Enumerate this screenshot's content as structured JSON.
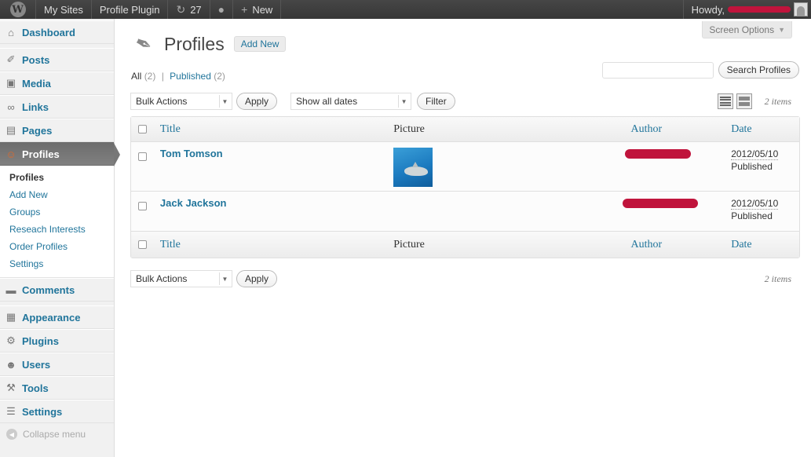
{
  "adminbar": {
    "my_sites": "My Sites",
    "site_name": "Profile Plugin",
    "updates_count": "27",
    "new_label": "New",
    "howdy": "Howdy,"
  },
  "sidebar": {
    "items": [
      {
        "label": "Dashboard",
        "icon": "dashboard-icon"
      },
      {
        "label": "Posts",
        "icon": "pin-icon"
      },
      {
        "label": "Media",
        "icon": "media-icon"
      },
      {
        "label": "Links",
        "icon": "link-icon"
      },
      {
        "label": "Pages",
        "icon": "pages-icon"
      },
      {
        "label": "Profiles",
        "icon": "person-icon"
      },
      {
        "label": "Comments",
        "icon": "comment-icon"
      },
      {
        "label": "Appearance",
        "icon": "appearance-icon"
      },
      {
        "label": "Plugins",
        "icon": "plugin-icon"
      },
      {
        "label": "Users",
        "icon": "users-icon"
      },
      {
        "label": "Tools",
        "icon": "tools-icon"
      },
      {
        "label": "Settings",
        "icon": "settings-icon"
      }
    ],
    "submenu": [
      "Profiles",
      "Add New",
      "Groups",
      "Reseach Interests",
      "Order Profiles",
      "Settings"
    ],
    "collapse": "Collapse menu"
  },
  "screen_options": "Screen Options",
  "page": {
    "title": "Profiles",
    "add_new": "Add New"
  },
  "filters": {
    "all": "All",
    "all_count": "(2)",
    "sep": "|",
    "published": "Published",
    "published_count": "(2)"
  },
  "search": {
    "value": "",
    "button": "Search Profiles"
  },
  "tablenav": {
    "bulk_actions": "Bulk Actions",
    "apply": "Apply",
    "dates": "Show all dates",
    "filter": "Filter",
    "items_count": "2 items"
  },
  "table": {
    "columns": {
      "title": "Title",
      "picture": "Picture",
      "author": "Author",
      "date": "Date"
    },
    "rows": [
      {
        "title": "Tom Tomson",
        "has_picture": true,
        "date": "2012/05/10",
        "status": "Published"
      },
      {
        "title": "Jack Jackson",
        "has_picture": false,
        "date": "2012/05/10",
        "status": "Published"
      }
    ]
  },
  "colors": {
    "link": "#21759b",
    "adminbar": "#464646",
    "redaction": "#c0143c"
  }
}
